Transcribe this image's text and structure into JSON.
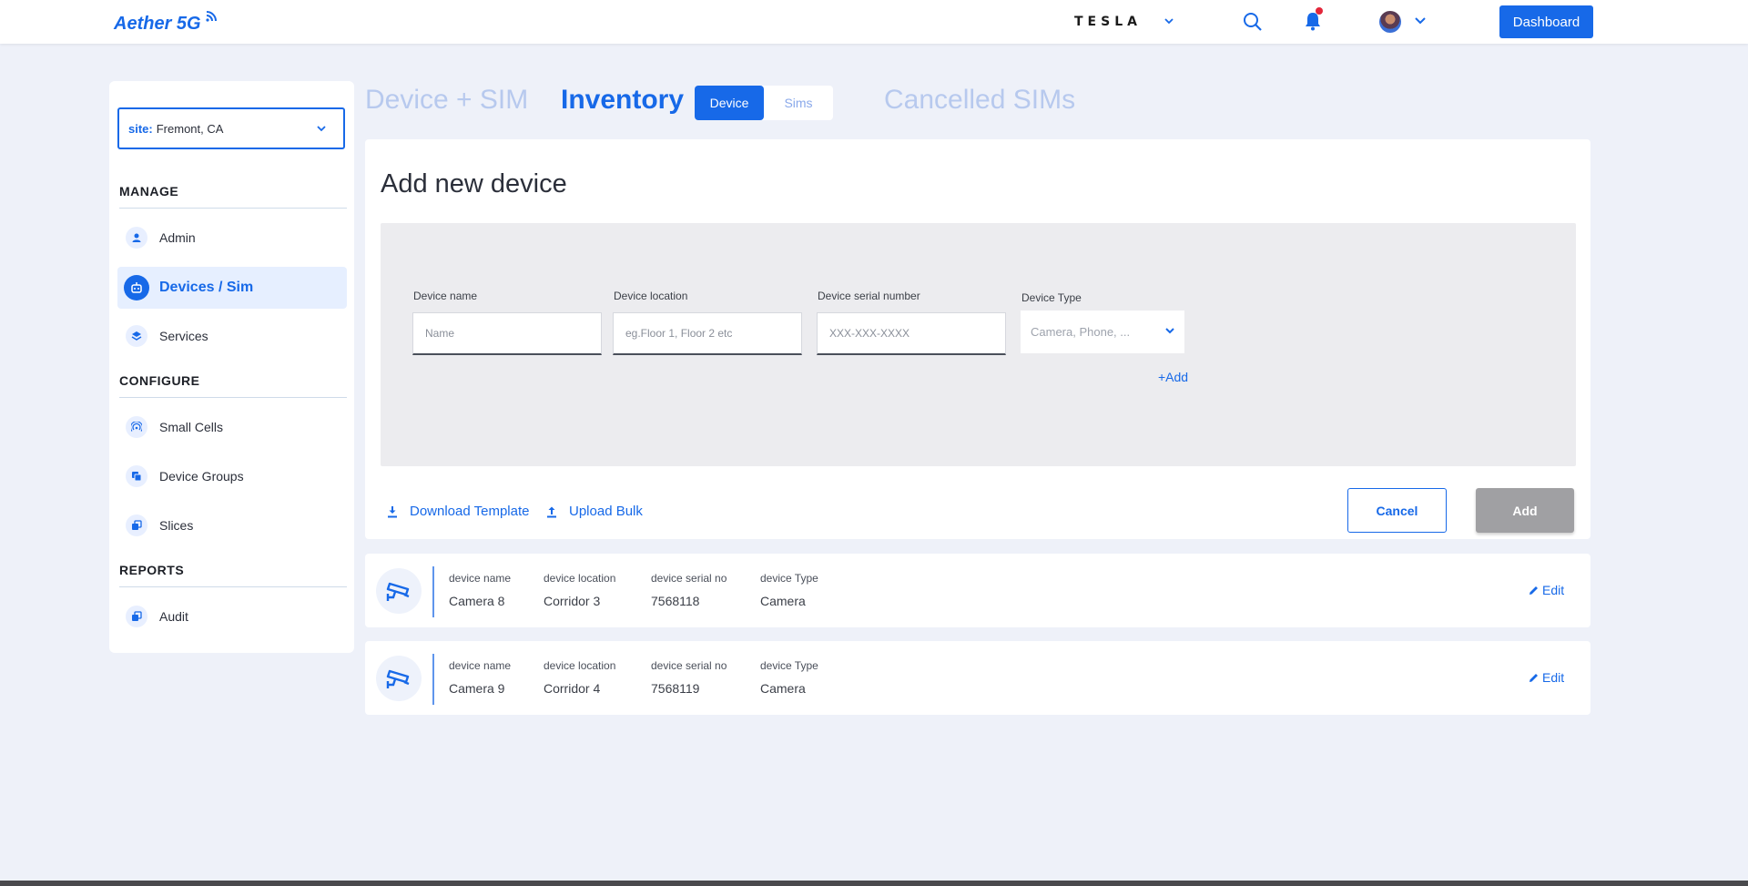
{
  "header": {
    "logo_text": "Aether 5G",
    "brand_text": "TESLA",
    "dashboard_label": "Dashboard"
  },
  "sidebar": {
    "site_key": "site:",
    "site_value": "Fremont, CA",
    "manage_heading": "MANAGE",
    "configure_heading": "CONFIGURE",
    "reports_heading": "REPORTS",
    "items": [
      {
        "label": "Admin",
        "icon": "person-icon"
      },
      {
        "label": "Devices / Sim",
        "icon": "robot-icon",
        "active": true
      },
      {
        "label": "Services",
        "icon": "layers-icon"
      },
      {
        "label": "Small Cells",
        "icon": "signal-icon"
      },
      {
        "label": "Device Groups",
        "icon": "group-icon"
      },
      {
        "label": "Slices",
        "icon": "slices-icon"
      },
      {
        "label": "Audit",
        "icon": "audit-icon"
      }
    ]
  },
  "tabs": {
    "device_sim": "Device + SIM",
    "inventory": "Inventory",
    "seg_device": "Device",
    "seg_sims": "Sims",
    "cancelled": "Cancelled SIMs"
  },
  "form": {
    "title": "Add new device",
    "name_label": "Device name",
    "name_placeholder": "Name",
    "location_label": "Device location",
    "location_placeholder": "eg.Floor 1, Floor 2 etc",
    "serial_label": "Device serial number",
    "serial_placeholder": "XXX-XXX-XXXX",
    "type_label": "Device Type",
    "type_placeholder": "Camera, Phone, ...",
    "add_link": "+Add",
    "download_template": "Download Template",
    "upload_bulk": "Upload Bulk",
    "cancel": "Cancel",
    "add": "Add"
  },
  "devices": {
    "headers": {
      "name": "device name",
      "location": "device location",
      "serial": "device serial no",
      "type": "device Type"
    },
    "edit_label": "Edit",
    "rows": [
      {
        "name": "Camera 8",
        "location": "Corridor 3",
        "serial": "7568118",
        "type": "Camera"
      },
      {
        "name": "Camera 9",
        "location": "Corridor 4",
        "serial": "7568119",
        "type": "Camera"
      }
    ]
  },
  "colors": {
    "accent": "#1769e8",
    "background": "#eef1f9",
    "notification_dot": "#e3263a",
    "disabled_button": "#a0a0a3"
  }
}
